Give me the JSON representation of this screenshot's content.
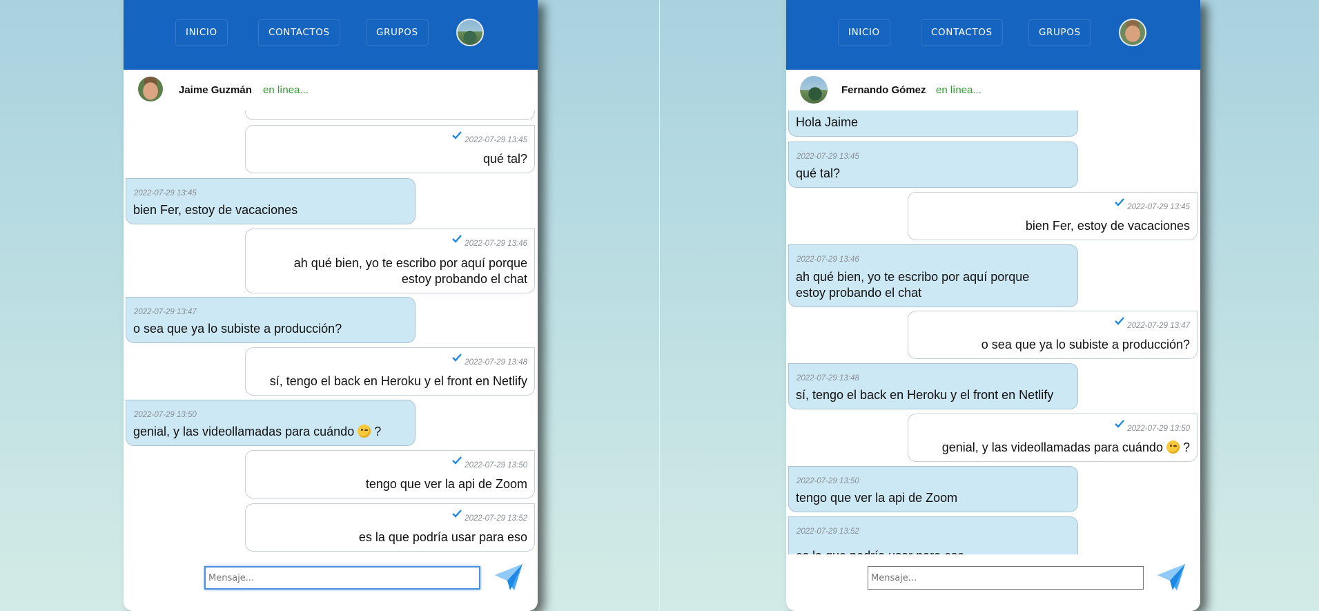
{
  "nav": [
    "INICIO",
    "CONTACTOS",
    "GRUPOS"
  ],
  "colors": {
    "topbar": "#1565c0",
    "incoming_bubble": "#cde8f5",
    "outgoing_bubble": "#ffffff",
    "online_status": "#2e9a2e",
    "check": "#1e88e5",
    "send_icon": "#42a5f5"
  },
  "left": {
    "contact_name": "Jaime Guzmán",
    "status": "en línea...",
    "input_placeholder": "Mensaje...",
    "messages": [
      {
        "dir": "out",
        "time": "",
        "text": ""
      },
      {
        "dir": "out",
        "time": "2022-07-29 13:45",
        "text": "qué tal?"
      },
      {
        "dir": "in",
        "time": "2022-07-29 13:45",
        "text": "bien Fer, estoy de vacaciones"
      },
      {
        "dir": "out",
        "time": "2022-07-29 13:46",
        "text": "ah qué bien, yo te escribo por aquí porque",
        "text2": "estoy probando el chat"
      },
      {
        "dir": "in",
        "time": "2022-07-29 13:47",
        "text": "o sea que ya lo subiste a producción?"
      },
      {
        "dir": "out",
        "time": "2022-07-29 13:48",
        "text": "sí, tengo el back en Heroku y el front en Netlify"
      },
      {
        "dir": "in",
        "time": "2022-07-29 13:50",
        "text": "genial, y las videollamadas para cuándo",
        "suffix": "?"
      },
      {
        "dir": "out",
        "time": "2022-07-29 13:50",
        "text": "tengo que ver la api de Zoom"
      },
      {
        "dir": "out",
        "time": "2022-07-29 13:52",
        "text": "es la que podría usar para eso"
      }
    ]
  },
  "right": {
    "contact_name": "Fernando Gómez",
    "status": "en línea...",
    "input_placeholder": "Mensaje...",
    "messages": [
      {
        "dir": "in",
        "time": "",
        "text": "Hola Jaime"
      },
      {
        "dir": "in",
        "time": "2022-07-29 13:45",
        "text": "qué tal?"
      },
      {
        "dir": "out",
        "time": "2022-07-29 13:45",
        "text": "bien Fer, estoy de vacaciones"
      },
      {
        "dir": "in",
        "time": "2022-07-29 13:46",
        "text": "ah qué bien, yo te escribo por aquí porque",
        "text2": "estoy probando el chat"
      },
      {
        "dir": "out",
        "time": "2022-07-29 13:47",
        "text": "o sea que ya lo subiste a producción?"
      },
      {
        "dir": "in",
        "time": "2022-07-29 13:48",
        "text": "sí, tengo el back en Heroku y el front en Netlify"
      },
      {
        "dir": "out",
        "time": "2022-07-29 13:50",
        "text": "genial, y las videollamadas para cuándo",
        "suffix": "?"
      },
      {
        "dir": "in",
        "time": "2022-07-29 13:50",
        "text": "tengo que ver la api de Zoom"
      },
      {
        "dir": "in",
        "time": "2022-07-29 13:52",
        "text": "es la que podría usar para eso"
      }
    ]
  }
}
